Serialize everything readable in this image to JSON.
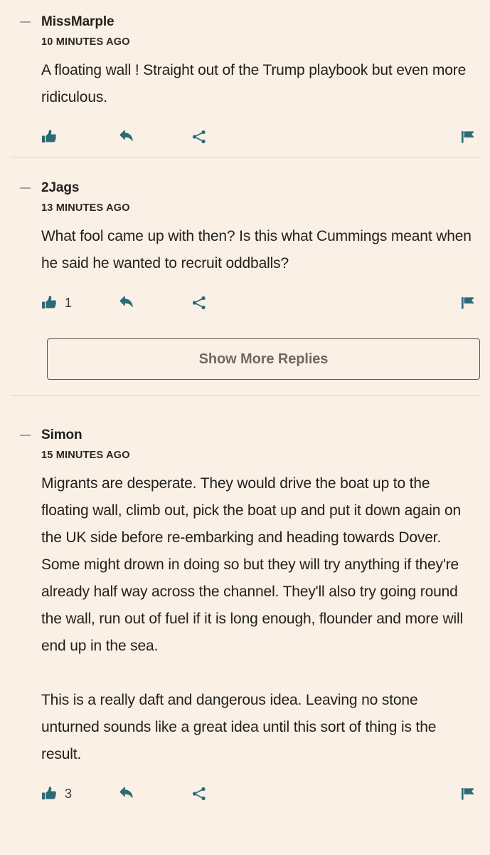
{
  "page": {
    "background_color": "#faf0e6",
    "text_color": "#23201d",
    "accent_color": "#2a6b75",
    "divider_color": "#ddd4ca",
    "collapse_icon_color": "#a9a29b"
  },
  "actions_labels": {
    "like": "Like",
    "reply": "Reply",
    "share": "Share",
    "flag": "Flag"
  },
  "icons": {
    "collapse": "minus-icon",
    "like": "thumbs-up-icon",
    "reply": "reply-arrow-icon",
    "share": "share-icon",
    "flag": "flag-icon"
  },
  "show_more": {
    "label": "Show More Replies"
  },
  "comments": [
    {
      "author": "MissMarple",
      "timestamp": "10 MINUTES AGO",
      "paragraphs": [
        "A floating wall ! Straight out of the Trump playbook but even more ridiculous."
      ],
      "like_count": ""
    },
    {
      "author": "2Jags",
      "timestamp": "13 MINUTES AGO",
      "paragraphs": [
        "What fool came up with then? Is this what Cummings meant when he said he wanted to recruit oddballs?"
      ],
      "like_count": "1"
    },
    {
      "author": "Simon",
      "timestamp": "15 MINUTES AGO",
      "paragraphs": [
        "Migrants are desperate. They would drive the boat up to the floating wall, climb out, pick the boat up and put it down again on the UK side before re-embarking and heading towards Dover. Some might drown in doing so but they will try anything if they're already half way across the channel. They'll also try going round the wall, run out of fuel if it is long enough, flounder and more will end up in the sea.",
        "This is a really daft and dangerous idea. Leaving no stone unturned sounds like a great idea until this sort of thing is the result."
      ],
      "like_count": "3"
    }
  ]
}
